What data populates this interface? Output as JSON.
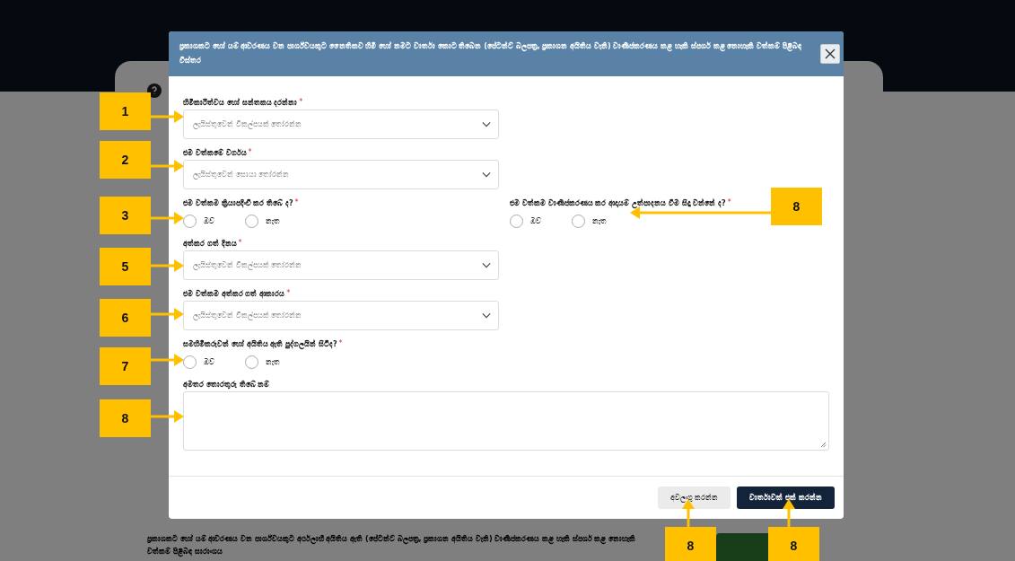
{
  "background": {
    "summary_text": "ප්‍රකාශකට හෝ යම් ආවරණය වන පාර්ශ්වයකුට අර්ථලාභී අයිතිය ඇති (පේටන්ට් බලපත්‍ර, ප්‍රකාශන අයිතිය වැනි) වාණිජකරණය කළ හැකි ස්පර්ශ කළ නොහැකි වත්කම් පිළිබඳ සාරාංශය"
  },
  "dialog": {
    "title": "ප්‍රකාශකට හෝ යම් ආවරණය වන පාර්ශ්වයකුට නෛතිකව හිමි හෝ නමට වාර්තා කොට තිබෙන (පේටන්ට් බලපත්‍ර, ප්‍රකාශන අයිතිය වැනි) වාණිජකරණය කළ හැකි ස්පර්ශ කළ නොහැකි වත්කම් පිළිබඳ විස්තර",
    "fields": [
      {
        "kind": "select",
        "label": "හිමිකාරිත්වය හෝ සන්තකය දරන්නා",
        "required_mark": "*",
        "placeholder": "ලැයිස්තුවෙන් විකල්පයක් තෝරන්න"
      },
      {
        "kind": "select",
        "label": "එම වත්කමේ වර්ගය",
        "required_mark": "*",
        "placeholder": "ලැයිස්තුවෙන් සොයා තෝරන්න"
      },
      {
        "kind": "radios",
        "questions": [
          {
            "label": "එම වත්කම ක්‍රියාපදිංචි කර තිබේ ද?",
            "required_mark": "*",
            "options": [
              {
                "label": "ඔව්",
                "selected": false
              },
              {
                "label": "නැත",
                "selected": false
              }
            ]
          },
          {
            "label": "එම වත්කම වාණිජකරණය කර ආදායම් උත්පාදනය වීම සිදු වන්නේ ද?",
            "required_mark": "*",
            "options": [
              {
                "label": "ඔව්",
                "selected": false
              },
              {
                "label": "නැත",
                "selected": false
              }
            ]
          }
        ]
      },
      {
        "kind": "select",
        "label": "අත්කර ගත් දිනය",
        "required_mark": "*",
        "placeholder": "ලැයිස්තුවෙන් විකල්පයක් තෝරන්න"
      },
      {
        "kind": "select",
        "label": "එම වත්කම අත්කර ගත් ආකාරය",
        "required_mark": "*",
        "placeholder": "ලැයිස්තුවෙන් විකල්පයක් තෝරන්න"
      },
      {
        "kind": "radios",
        "questions": [
          {
            "label": "සමහිමිකරුවන් හෝ අයිතිය ඇති පුද්ගලයින් සිටිද?",
            "required_mark": "*",
            "options": [
              {
                "label": "ඔව්",
                "selected": false
              },
              {
                "label": "නැත",
                "selected": false
              }
            ]
          }
        ]
      },
      {
        "kind": "textarea",
        "label": "අමතර තොරතුරු තිබේ නම්"
      }
    ],
    "buttons": [
      {
        "label": "අවලංගු කරන්න",
        "kind": "secondary"
      },
      {
        "label": "වාර්තාවක් එක් කරන්න",
        "kind": "primary"
      }
    ]
  },
  "annotations": [
    {
      "number": "1"
    },
    {
      "number": "2"
    },
    {
      "number": "3"
    },
    {
      "number": "5"
    },
    {
      "number": "6"
    },
    {
      "number": "7"
    },
    {
      "number": "8"
    },
    {
      "number": "8"
    },
    {
      "number": "8"
    },
    {
      "number": "8"
    }
  ]
}
